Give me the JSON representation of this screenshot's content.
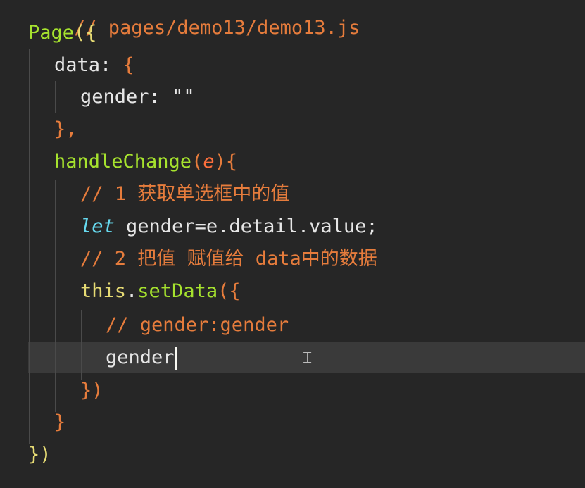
{
  "editor": {
    "lines": [
      "// pages/demo13/demo13.js",
      "Page({",
      "data: {",
      "gender: \"\"",
      "},",
      "handleChange(e){",
      "// 1 获取单选框中的值",
      "let gender=e.detail.value;",
      "// 2 把值 赋值给 data中的数据",
      "this.setData({",
      "// gender:gender",
      "gender",
      "})",
      "}",
      "})"
    ],
    "tokens": {
      "l0": "// pages/demo13/demo13.js",
      "l1_page": "Page",
      "l1_paren": "({",
      "l2_data": "data",
      "l2_colon": ": ",
      "l2_brace": "{",
      "l3_key": "gender",
      "l3_colon": ": ",
      "l3_str": "\"\"",
      "l4": "},",
      "l5_fn": "handleChange",
      "l5_open": "(",
      "l5_param": "e",
      "l5_close": "){",
      "l6": "// 1 获取单选框中的值",
      "l7_let": "let",
      "l7_rest": " gender=e.detail.value;",
      "l8": "// 2 把值 赋值给 data中的数据",
      "l9_this": "this",
      "l9_dot": ".",
      "l9_method": "setData",
      "l9_paren": "({",
      "l10": "// gender:gender",
      "l11": "gender",
      "l12": "})",
      "l13": "}",
      "l14": "})"
    },
    "cursor_line": 11,
    "mouse_cursor_icon": "ibeam-cursor-icon"
  }
}
